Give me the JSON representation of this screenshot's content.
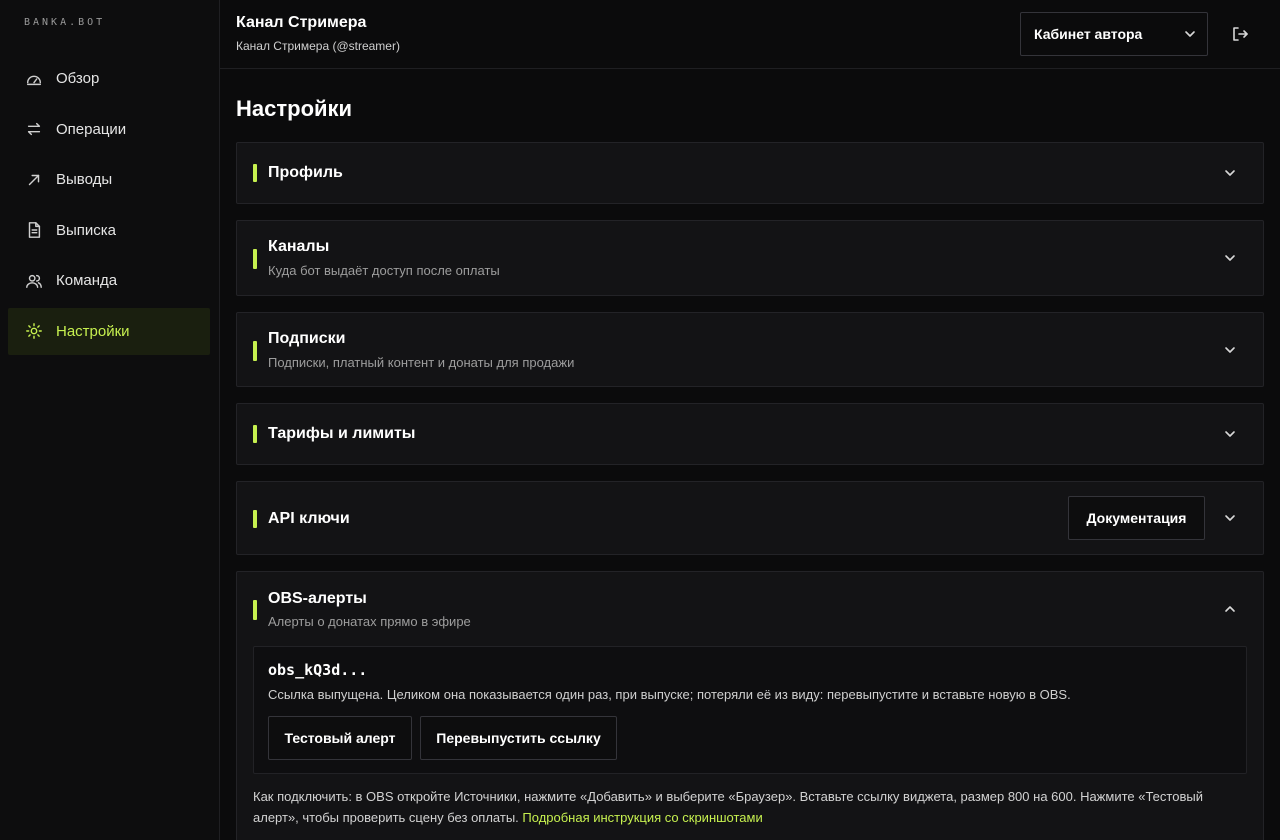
{
  "brand": "BANKA.BOT",
  "sidebar": {
    "items": [
      {
        "label": "Обзор",
        "icon": "gauge-icon"
      },
      {
        "label": "Операции",
        "icon": "arrows-swap-icon"
      },
      {
        "label": "Выводы",
        "icon": "arrow-up-right-icon"
      },
      {
        "label": "Выписка",
        "icon": "document-icon"
      },
      {
        "label": "Команда",
        "icon": "users-icon"
      },
      {
        "label": "Настройки",
        "icon": "sun-gear-icon",
        "active": true
      }
    ]
  },
  "header": {
    "title": "Канал Стримера",
    "subtitle": "Канал Стримера (@streamer)",
    "cabinet_select": "Кабинет автора"
  },
  "page": {
    "title": "Настройки"
  },
  "sections": {
    "profile": {
      "title": "Профиль"
    },
    "channels": {
      "title": "Каналы",
      "subtitle": "Куда бот выдаёт доступ после оплаты"
    },
    "subscriptions": {
      "title": "Подписки",
      "subtitle": "Подписки, платный контент и донаты для продажи"
    },
    "tariffs": {
      "title": "Тарифы и лимиты"
    },
    "api": {
      "title": "API ключи",
      "docs_button": "Документация"
    },
    "obs": {
      "title": "OBS-алерты",
      "subtitle": "Алерты о донатах прямо в эфире",
      "token": "obs_kQ3d...",
      "token_note": "Ссылка выпущена. Целиком она показывается один раз, при выпуске; потеряли её из виду: перевыпустите и вставьте новую в OBS.",
      "test_button": "Тестовый алерт",
      "reissue_button": "Перевыпустить ссылку",
      "howto_text": "Как подключить: в OBS откройте Источники, нажмите «Добавить» и выберите «Браузер». Вставьте ссылку виджета, размер 800 на 600. Нажмите «Тестовый алерт», чтобы проверить сцену без оплаты.",
      "howto_link": "Подробная инструкция со скриншотами"
    }
  },
  "colors": {
    "accent": "#c6f04f",
    "background": "#0b0b0c",
    "card": "#131315"
  }
}
